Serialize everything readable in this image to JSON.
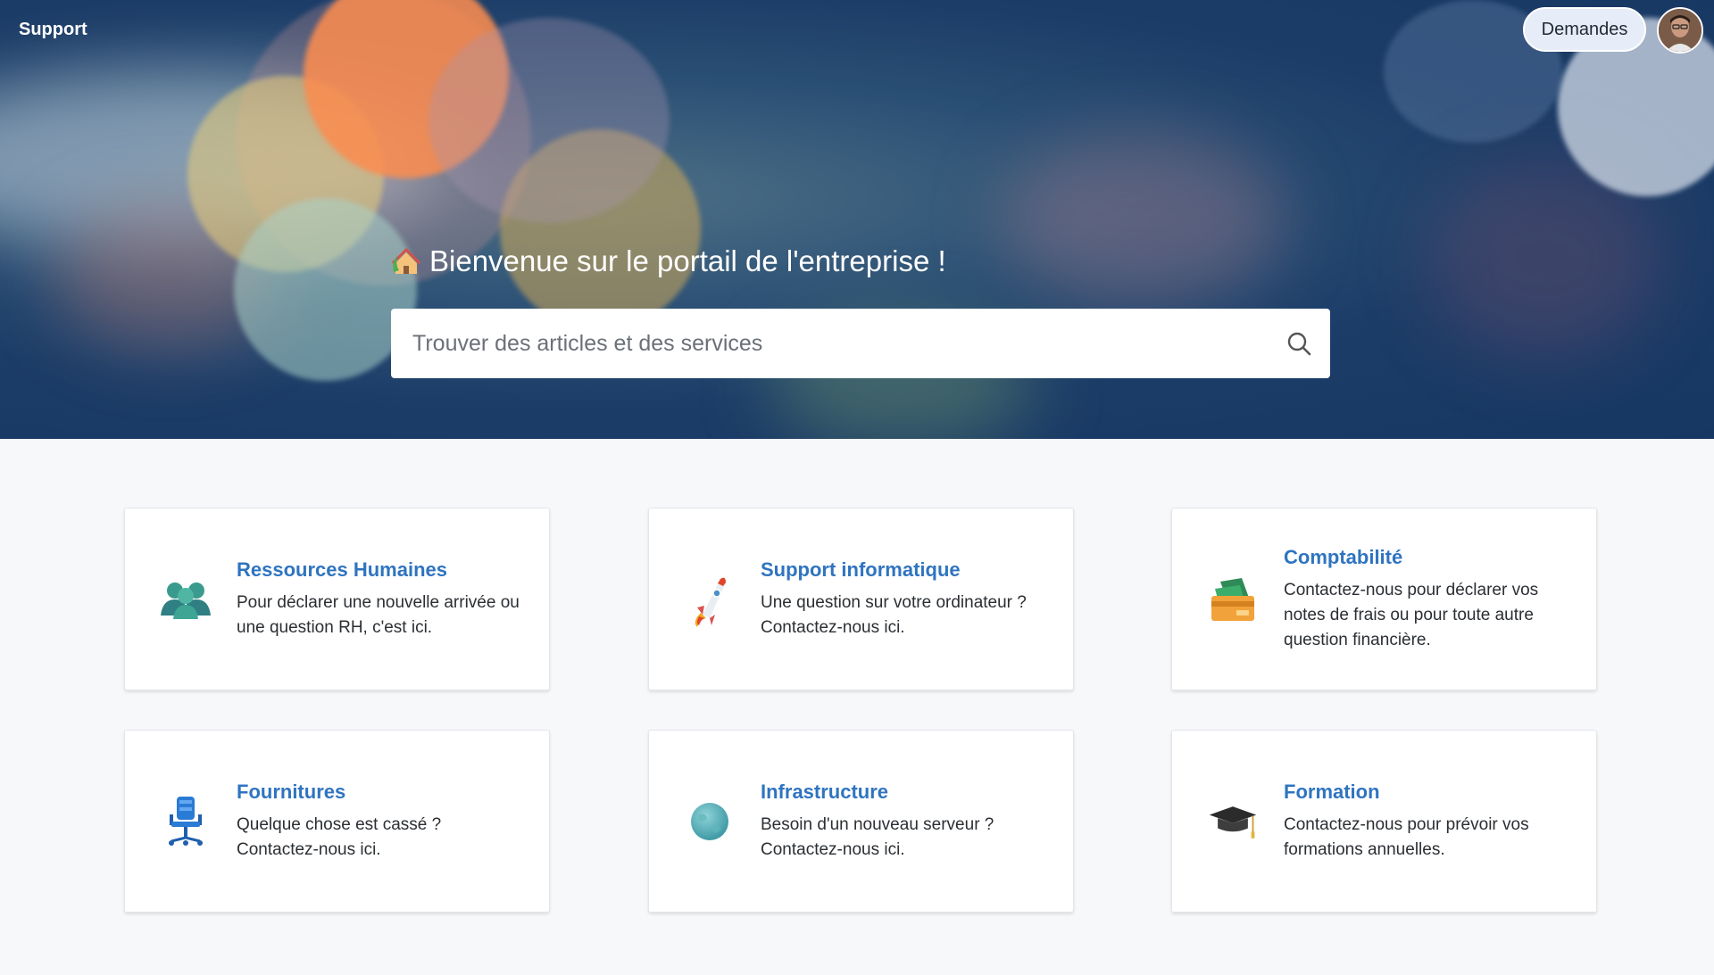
{
  "header": {
    "brand": "Support",
    "requests_label": "Demandes"
  },
  "hero": {
    "welcome_text": "Bienvenue sur le portail de l'entreprise !",
    "search": {
      "placeholder": "Trouver des articles et des services",
      "value": ""
    }
  },
  "categories": [
    {
      "title": "Ressources Humaines",
      "description": "Pour déclarer une nouvelle arrivée ou une question RH, c'est ici.",
      "icon": "people-icon"
    },
    {
      "title": "Support informatique",
      "description": "Une question sur votre ordinateur ? Contactez-nous ici.",
      "icon": "rocket-icon"
    },
    {
      "title": "Comptabilité",
      "description": "Contactez-nous pour déclarer vos notes de frais ou pour toute autre question financière.",
      "icon": "money-icon"
    },
    {
      "title": "Fournitures",
      "description": "Quelque chose est cassé ? Contactez-nous ici.",
      "icon": "office-chair-icon"
    },
    {
      "title": "Infrastructure",
      "description": "Besoin d'un nouveau serveur ? Contactez-nous ici.",
      "icon": "globe-icon"
    },
    {
      "title": "Formation",
      "description": "Contactez-nous pour prévoir vos formations annuelles.",
      "icon": "graduation-cap-icon"
    }
  ],
  "colors": {
    "link": "#2f74c0",
    "background": "#f7f8fa",
    "hero": "#1c3d68"
  }
}
